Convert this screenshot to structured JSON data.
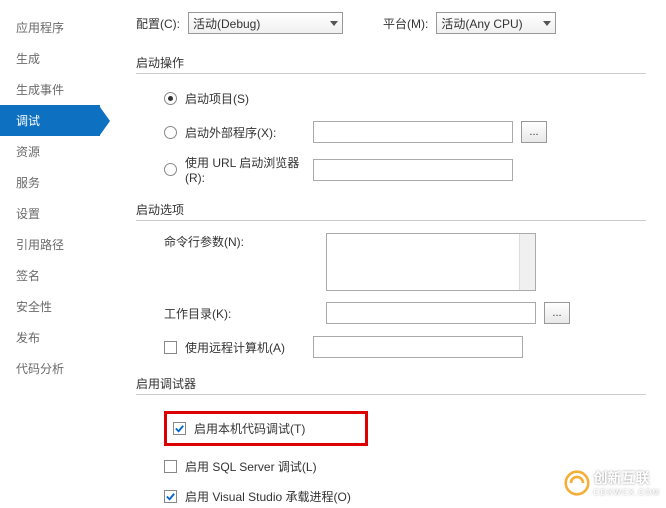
{
  "sidebar": {
    "items": [
      {
        "label": "应用程序"
      },
      {
        "label": "生成"
      },
      {
        "label": "生成事件"
      },
      {
        "label": "调试"
      },
      {
        "label": "资源"
      },
      {
        "label": "服务"
      },
      {
        "label": "设置"
      },
      {
        "label": "引用路径"
      },
      {
        "label": "签名"
      },
      {
        "label": "安全性"
      },
      {
        "label": "发布"
      },
      {
        "label": "代码分析"
      }
    ],
    "activeIndex": 3
  },
  "top": {
    "config_label": "配置(C):",
    "config_value": "活动(Debug)",
    "platform_label": "平台(M):",
    "platform_value": "活动(Any CPU)"
  },
  "groups": {
    "start_action": {
      "title": "启动操作",
      "start_project": "启动项目(S)",
      "start_external": "启动外部程序(X):",
      "start_url": "使用 URL 启动浏览器(R):",
      "selected": "start_project"
    },
    "start_options": {
      "title": "启动选项",
      "args_label": "命令行参数(N):",
      "workdir_label": "工作目录(K):",
      "remote_label": "使用远程计算机(A)",
      "args_value": "",
      "workdir_value": "",
      "remote_value": "",
      "remote_checked": false
    },
    "debuggers": {
      "title": "启用调试器",
      "native_label": "启用本机代码调试(T)",
      "sql_label": "启用 SQL Server 调试(L)",
      "vshost_label": "启用 Visual Studio 承载进程(O)",
      "native_checked": true,
      "sql_checked": false,
      "vshost_checked": true
    }
  },
  "browse_btn": "...",
  "watermark": {
    "brand": "创新互联",
    "sub": "CDXWCX.COM"
  }
}
